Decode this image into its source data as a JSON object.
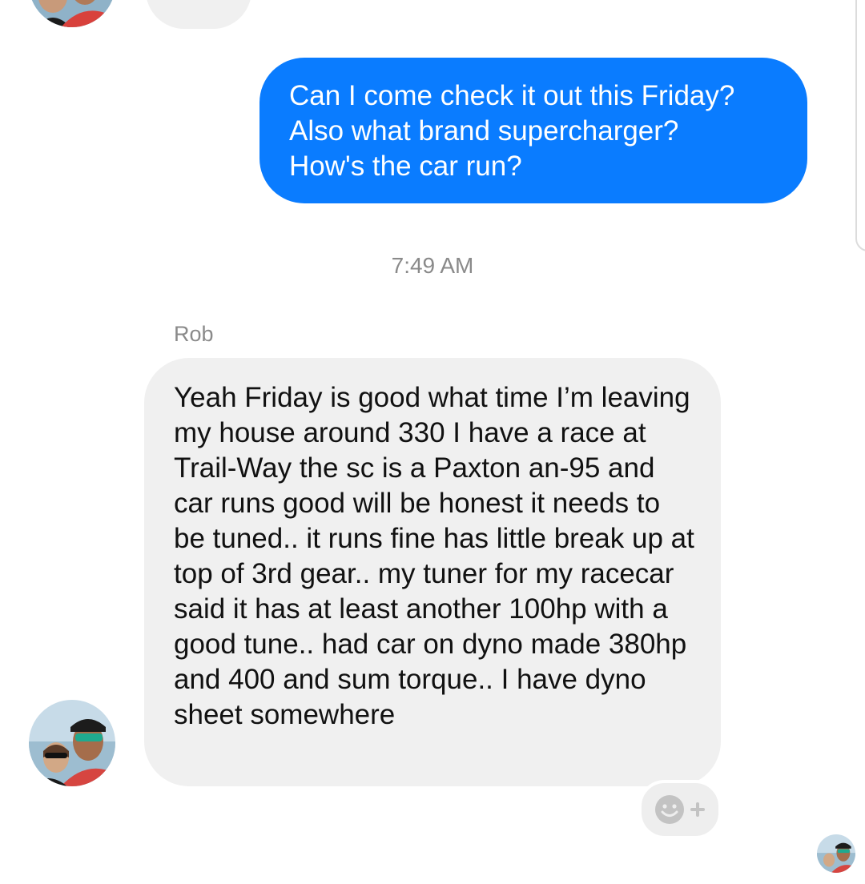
{
  "conversation": {
    "outgoing_message": "Can I come check it out this Friday?\nAlso what brand supercharger?\nHow's the car run?",
    "timestamp": "7:49 AM",
    "sender_name": "Rob",
    "incoming_message": "Yeah Friday is good what time I’m leaving my house around 330 I have a race at Trail-Way the sc is a Paxton an-95 and car runs good will be honest it needs to be tuned.. it runs fine has little break up at top of 3rd gear.. my tuner for my racecar said it has at least another 100hp with a good tune.. had car on dyno made 380hp and 400 and sum torque.. I have dyno sheet somewhere"
  },
  "icons": {
    "react": "add-reaction-icon"
  },
  "colors": {
    "outgoing_bubble": "#0a7cff",
    "incoming_bubble": "#f0f0f0",
    "meta_text": "#8a8a8a"
  }
}
